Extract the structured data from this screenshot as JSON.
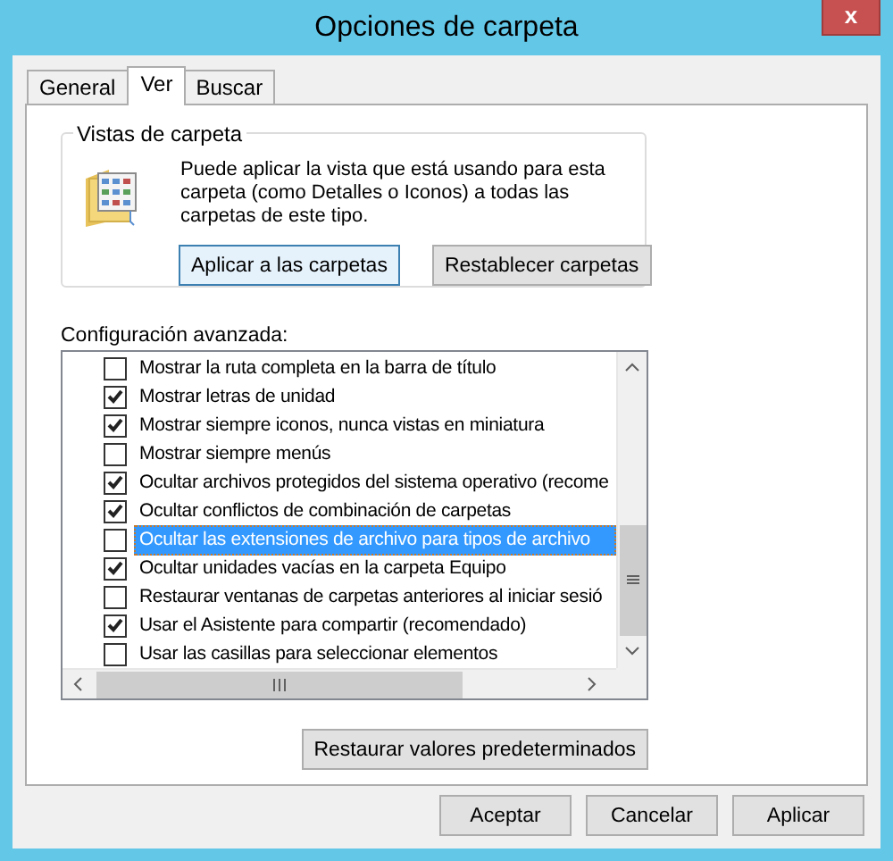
{
  "window": {
    "title": "Opciones de carpeta",
    "close": "x"
  },
  "tabs": [
    {
      "label": "General",
      "selected": false
    },
    {
      "label": "Ver",
      "selected": true
    },
    {
      "label": "Buscar",
      "selected": false
    }
  ],
  "folder_views": {
    "title": "Vistas de carpeta",
    "description": "Puede aplicar la vista que está usando para esta carpeta (como Detalles o Iconos) a todas las carpetas de este tipo.",
    "buttons": [
      {
        "label": "Aplicar a las carpetas",
        "default": true
      },
      {
        "label": "Restablecer carpetas",
        "default": false
      }
    ]
  },
  "advanced_settings": {
    "label": "Configuración avanzada:",
    "items": [
      {
        "label": "Mostrar la ruta completa en la barra de título",
        "checked": false,
        "selected": false
      },
      {
        "label": "Mostrar letras de unidad",
        "checked": true,
        "selected": false
      },
      {
        "label": "Mostrar siempre iconos, nunca vistas en miniatura",
        "checked": true,
        "selected": false
      },
      {
        "label": "Mostrar siempre menús",
        "checked": false,
        "selected": false
      },
      {
        "label": "Ocultar archivos protegidos del sistema operativo (recome",
        "checked": true,
        "selected": false
      },
      {
        "label": "Ocultar conflictos de combinación de carpetas",
        "checked": true,
        "selected": false
      },
      {
        "label": "Ocultar las extensiones de archivo para tipos de archivo",
        "checked": false,
        "selected": true
      },
      {
        "label": "Ocultar unidades vacías en la carpeta Equipo",
        "checked": true,
        "selected": false
      },
      {
        "label": "Restaurar ventanas de carpetas anteriores al iniciar sesió",
        "checked": false,
        "selected": false
      },
      {
        "label": "Usar el Asistente para compartir (recomendado)",
        "checked": true,
        "selected": false
      },
      {
        "label": "Usar las casillas para seleccionar elementos",
        "checked": false,
        "selected": false
      }
    ]
  },
  "restore_button": {
    "label": "Restaurar valores predeterminados",
    "default": false
  },
  "buttons": [
    {
      "label": "Aceptar",
      "default": false
    },
    {
      "label": "Cancelar",
      "default": false
    },
    {
      "label": "Aplicar",
      "default": false
    }
  ]
}
